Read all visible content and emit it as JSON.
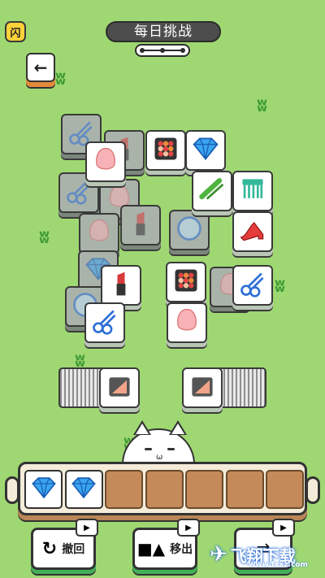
{
  "header": {
    "flash_icon_text": "闪",
    "title": "每日挑战",
    "back_icon": "arrow-left-icon"
  },
  "tiles": [
    {
      "icon": "scissors",
      "state": "dim"
    },
    {
      "icon": "lipstick",
      "state": "dim"
    },
    {
      "icon": "sponge",
      "state": "active"
    },
    {
      "icon": "palette",
      "state": "active"
    },
    {
      "icon": "diamond",
      "state": "active"
    },
    {
      "icon": "scissors",
      "state": "dim"
    },
    {
      "icon": "sponge",
      "state": "dim"
    },
    {
      "icon": "curler",
      "state": "active"
    },
    {
      "icon": "comb",
      "state": "active"
    },
    {
      "icon": "sponge",
      "state": "dim"
    },
    {
      "icon": "lipstick",
      "state": "dim"
    },
    {
      "icon": "mirror",
      "state": "dim"
    },
    {
      "icon": "heels",
      "state": "active"
    },
    {
      "icon": "diamond",
      "state": "dim"
    },
    {
      "icon": "lipstick",
      "state": "active"
    },
    {
      "icon": "palette",
      "state": "active"
    },
    {
      "icon": "scissors",
      "state": "active"
    },
    {
      "icon": "mirror",
      "state": "dim"
    },
    {
      "icon": "scissors",
      "state": "active"
    },
    {
      "icon": "sponge",
      "state": "active"
    },
    {
      "icon": "sponge",
      "state": "dim"
    },
    {
      "icon": "powder",
      "state": "active"
    },
    {
      "icon": "powder",
      "state": "active"
    }
  ],
  "tray": {
    "slots": [
      "diamond",
      "diamond",
      "",
      "",
      "",
      "",
      ""
    ]
  },
  "tools": [
    {
      "label": "撤回",
      "icon": "undo-icon"
    },
    {
      "label": "移出",
      "icon": "move-out-icon"
    },
    {
      "label": "",
      "icon": "shuffle-icon"
    }
  ],
  "watermark": {
    "brand": "飞翔下载",
    "url": "www.fxxz.com"
  },
  "colors": {
    "background": "#9fd872",
    "tile_face": "#ffffff",
    "tray_slot": "#c48a5a",
    "button_accent": "#43b05a"
  }
}
